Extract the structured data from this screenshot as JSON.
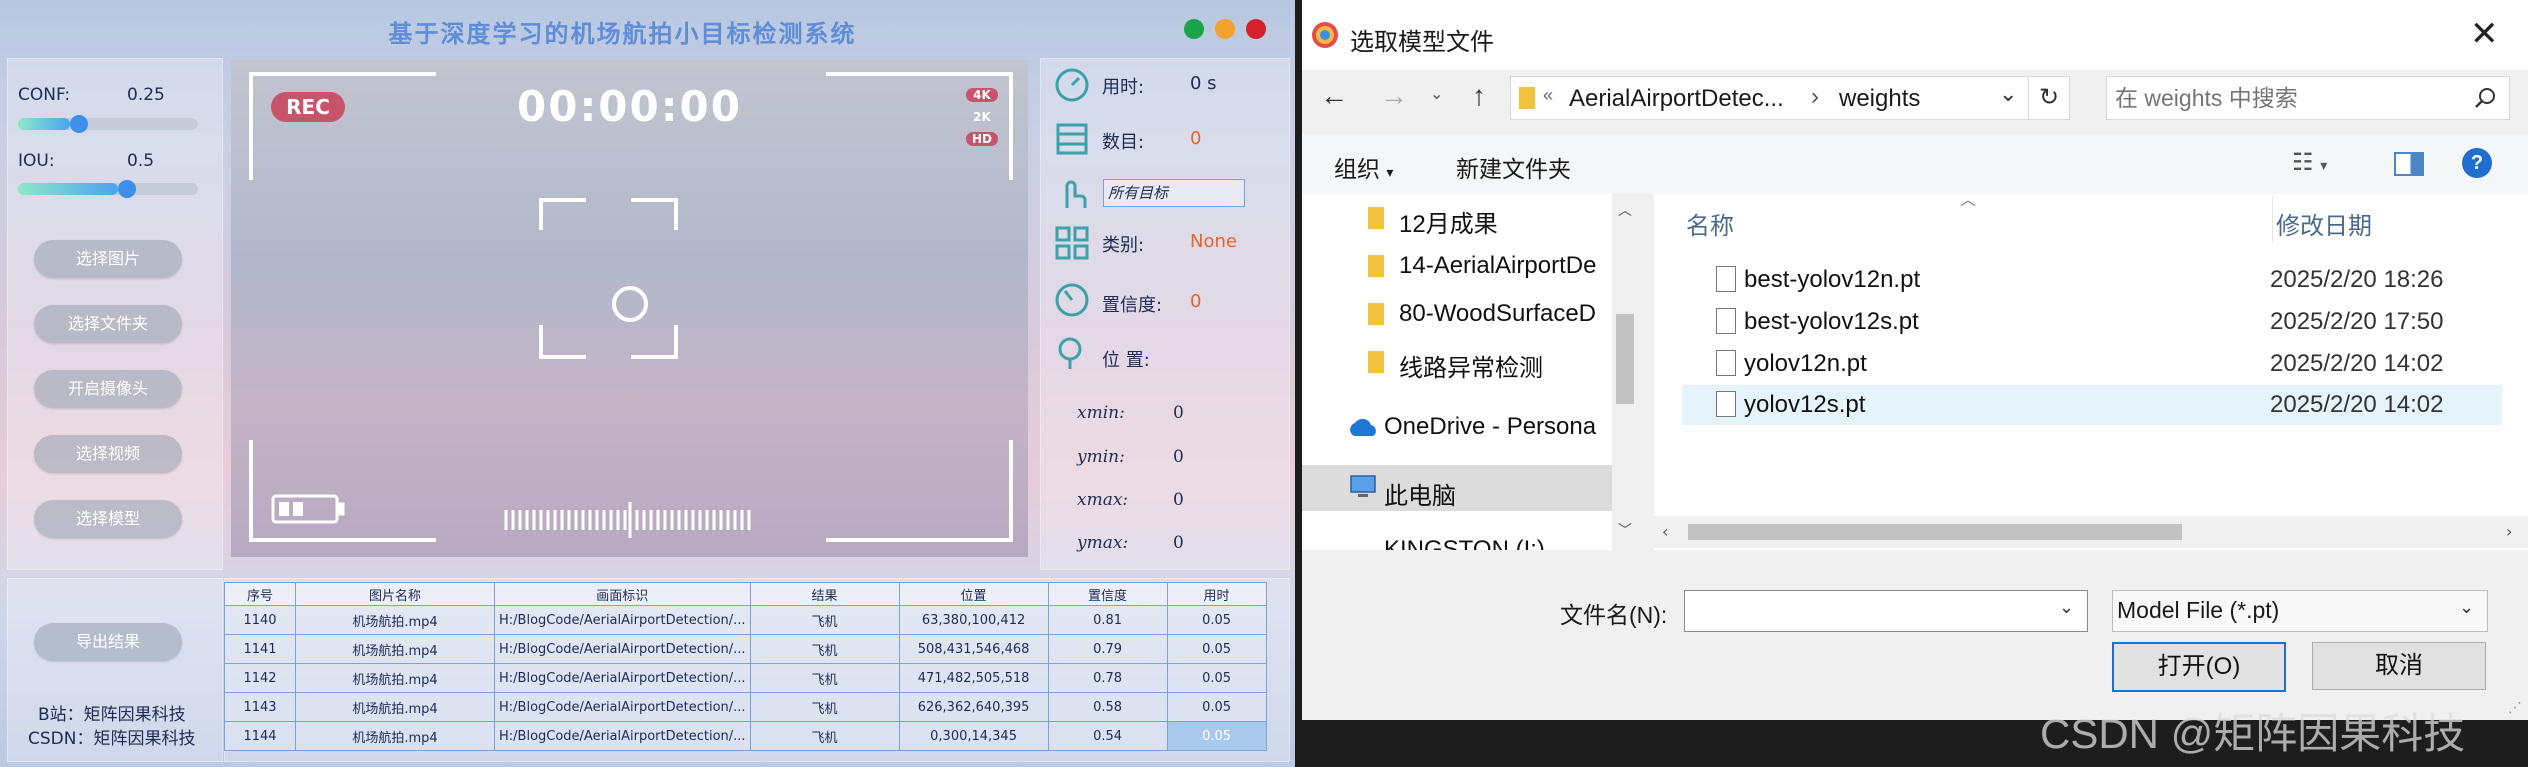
{
  "app": {
    "title": "基于深度学习的机场航拍小目标检测系统",
    "window_dots": {
      "green": "#1aa34a",
      "yellow": "#f3a32b",
      "red": "#d5212e"
    },
    "conf": {
      "label": "CONF:",
      "value": "0.25",
      "fraction": 0.25
    },
    "iou": {
      "label": "IOU:",
      "value": "0.5",
      "fraction": 0.5
    },
    "buttons": {
      "select_image": "选择图片",
      "select_folder": "选择文件夹",
      "open_camera": "开启摄像头",
      "select_video": "选择视频",
      "select_model": "选择模型",
      "export": "导出结果"
    },
    "credits": {
      "bilibili": "B站：矩阵因果科技",
      "csdn": "CSDN：矩阵因果科技"
    },
    "video": {
      "rec": "REC",
      "timer": "00:00:00",
      "badges": [
        "4K",
        "2K",
        "HD"
      ]
    },
    "info": {
      "time_label": "用时:",
      "time_value": "0 s",
      "count_label": "数目:",
      "count_value": "0",
      "target_select": "所有目标",
      "class_label": "类别:",
      "class_value": "None",
      "conf_label": "置信度:",
      "conf_value": "0",
      "pos_label": "位 置:",
      "xmin_label": "xmin:",
      "xmin_value": "0",
      "ymin_label": "ymin:",
      "ymin_value": "0",
      "xmax_label": "xmax:",
      "xmax_value": "0",
      "ymax_label": "ymax:",
      "ymax_value": "0"
    },
    "table": {
      "headers": [
        "序号",
        "图片名称",
        "画面标识",
        "结果",
        "位置",
        "置信度",
        "用时"
      ],
      "rows": [
        [
          "1140",
          "机场航拍.mp4",
          "H:/BlogCode/AerialAirportDetection/...",
          "飞机",
          "63,380,100,412",
          "0.81",
          "0.05"
        ],
        [
          "1141",
          "机场航拍.mp4",
          "H:/BlogCode/AerialAirportDetection/...",
          "飞机",
          "508,431,546,468",
          "0.79",
          "0.05"
        ],
        [
          "1142",
          "机场航拍.mp4",
          "H:/BlogCode/AerialAirportDetection/...",
          "飞机",
          "471,482,505,518",
          "0.78",
          "0.05"
        ],
        [
          "1143",
          "机场航拍.mp4",
          "H:/BlogCode/AerialAirportDetection/...",
          "飞机",
          "626,362,640,395",
          "0.58",
          "0.05"
        ],
        [
          "1144",
          "机场航拍.mp4",
          "H:/BlogCode/AerialAirportDetection/...",
          "飞机",
          "0,300,14,345",
          "0.54",
          "0.05"
        ]
      ]
    }
  },
  "dialog": {
    "title": "选取模型文件",
    "path_parent": "AerialAirportDetec...",
    "path_current": "weights",
    "search_placeholder": "在 weights 中搜索",
    "organize": "组织",
    "new_folder": "新建文件夹",
    "help": "?",
    "nav_items": [
      "12月成果",
      "14-AerialAirportDe",
      "80-WoodSurfaceD",
      "线路异常检测",
      "OneDrive - Persona",
      "此电脑",
      "KINGSTON (I:)"
    ],
    "col_name": "名称",
    "col_date": "修改日期",
    "files": [
      {
        "name": "best-yolov12n.pt",
        "date": "2025/2/20 18:26"
      },
      {
        "name": "best-yolov12s.pt",
        "date": "2025/2/20 17:50"
      },
      {
        "name": "yolov12n.pt",
        "date": "2025/2/20 14:02"
      },
      {
        "name": "yolov12s.pt",
        "date": "2025/2/20 14:02"
      }
    ],
    "filename_label": "文件名(N):",
    "filename_value": "",
    "filetype": "Model File (*.pt)",
    "open": "打开(O)",
    "cancel": "取消"
  },
  "watermark": "CSDN @矩阵因果科技"
}
